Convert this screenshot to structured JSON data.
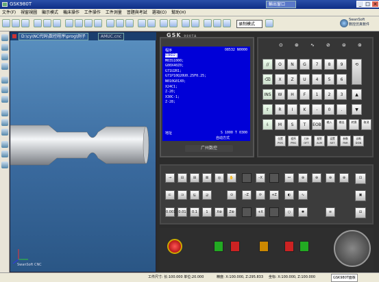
{
  "title": "GSK980T",
  "task_chip": "輸出窗口",
  "menu": [
    "文件(F)",
    "視窗視圖",
    "顯示模式",
    "機床操作",
    "工件操作",
    "工件測量",
    "習題與考試",
    "選項(O)",
    "幫助(H)"
  ],
  "mode_select": "录制模式",
  "softlogo": {
    "line1": "SwanSoft",
    "line2": "數控仿真軟件"
  },
  "tabs": {
    "active": "D:\\cy\\NC代码\\数控程序\\prog\\例子",
    "inactive": "AMUC.cnc"
  },
  "viewport_watermark": "SwanSoft CNC",
  "brand": {
    "name": "GSK",
    "model": "980TA",
    "footer": "广州数控"
  },
  "screen": {
    "mode": "程序",
    "prog_no": "O8532 N0000",
    "lines": [
      "O3KD2;",
      "M03S1000;",
      "G00X40Z0;",
      "G71U2R1;",
      "G71P10Q20U0.25F0.25;",
      "N010G01X0;",
      "X24C1;",
      "Z-20;",
      "X30C-1;",
      "Z-28;"
    ],
    "footer_left": "地址",
    "footer_right": "S 1000 T 0300",
    "footer_mode": "自动方式"
  },
  "keys": [
    "O",
    "N",
    "G",
    "7",
    "8",
    "9",
    "X",
    "Z",
    "U",
    "4",
    "5",
    "6",
    "W",
    "H",
    "F",
    "1",
    "2",
    "3",
    "R",
    "I",
    "K",
    "-",
    "0",
    ".",
    "M",
    "S",
    "T",
    "EOB"
  ],
  "side_keys": [
    "//",
    "⌫",
    "INS",
    "⇧",
    "⇩"
  ],
  "edit_keys": [
    "输入",
    "输出",
    "转换",
    "取消"
  ],
  "fn_keys": [
    "位置 POS",
    "程序 PRG",
    "刀补 OFT",
    "报警 ALM",
    "设置 SET",
    "参数 PAR",
    "诊断 DGN"
  ],
  "ctrl_row1": [
    "→",
    "⊟",
    "⊞",
    "⊠",
    "◎",
    "✋",
    "",
    "–X",
    "",
    "",
    "",
    "⚯",
    "⊕",
    "⊕",
    "⊕"
  ],
  "ctrl_row2": [
    "⊏",
    "⊐",
    "⊑",
    "⊒",
    "⊙",
    "",
    "–Z",
    "",
    "+Z",
    "",
    "◐",
    "∿"
  ],
  "ctrl_row3": [
    "0.001",
    "0.01",
    "0.1",
    "1",
    "X⊕",
    "Z⊕",
    "",
    "+X",
    "",
    "",
    "○",
    "✱"
  ],
  "status": {
    "a": "工件尺寸: 长:100.000 单位:20.000",
    "b": "精度: X:100.000, Z:295.833",
    "c": "坐标: X:100.000, Z:100.000",
    "d": "GSK980T面板"
  },
  "colors": {
    "screen": "#0000d8",
    "panel": "#2c2c2c",
    "estop": "#cc1111",
    "titlebar": "#1a3a96"
  }
}
